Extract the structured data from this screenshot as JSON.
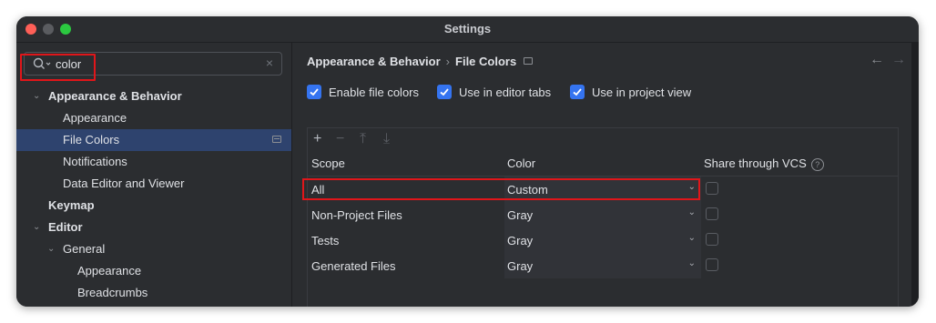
{
  "window": {
    "title": "Settings"
  },
  "search": {
    "value": "color"
  },
  "tree": [
    {
      "label": "Appearance & Behavior",
      "level": 0,
      "expanded": true,
      "bold": true
    },
    {
      "label": "Appearance",
      "level": 1
    },
    {
      "label": "File Colors",
      "level": 1,
      "selected": true,
      "badge": true
    },
    {
      "label": "Notifications",
      "level": 1
    },
    {
      "label": "Data Editor and Viewer",
      "level": 1
    },
    {
      "label": "Keymap",
      "level": 0,
      "bold": true
    },
    {
      "label": "Editor",
      "level": 0,
      "expanded": true,
      "bold": true
    },
    {
      "label": "General",
      "level": 1,
      "expanded": true
    },
    {
      "label": "Appearance",
      "level": 2
    },
    {
      "label": "Breadcrumbs",
      "level": 2
    }
  ],
  "breadcrumb": {
    "parent": "Appearance & Behavior",
    "current": "File Colors"
  },
  "options": [
    {
      "label": "Enable file colors",
      "checked": true
    },
    {
      "label": "Use in editor tabs",
      "checked": true
    },
    {
      "label": "Use in project view",
      "checked": true
    }
  ],
  "table": {
    "headers": {
      "scope": "Scope",
      "color": "Color",
      "vcs": "Share through VCS"
    },
    "rows": [
      {
        "scope": "All",
        "color": "Custom",
        "shared": false
      },
      {
        "scope": "Non-Project Files",
        "color": "Gray",
        "shared": false
      },
      {
        "scope": "Tests",
        "color": "Gray",
        "shared": false
      },
      {
        "scope": "Generated Files",
        "color": "Gray",
        "shared": false
      }
    ]
  },
  "icons": {
    "add": "plus-icon",
    "remove": "minus-icon",
    "move_up": "arrow-up-icon",
    "move_down": "arrow-down-icon",
    "back": "arrow-left-icon",
    "forward": "arrow-right-icon"
  },
  "colors": {
    "accent": "#3574f0",
    "selection": "#2e436e",
    "highlight": "#e0161a",
    "background": "#2b2d30"
  }
}
